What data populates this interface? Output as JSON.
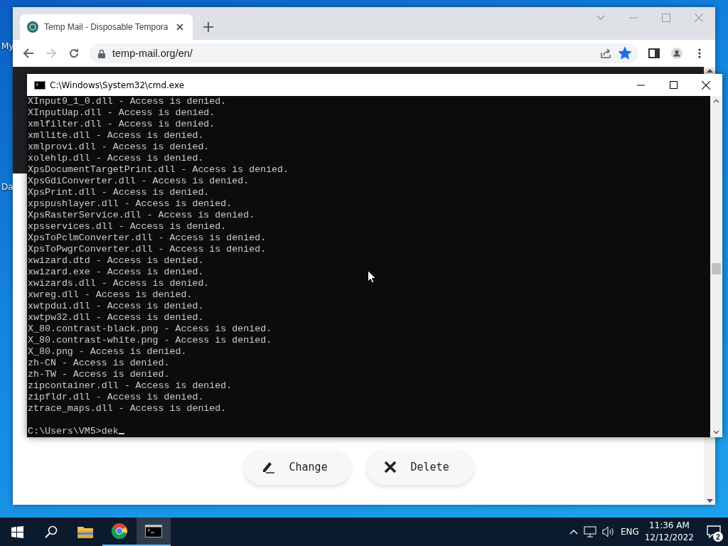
{
  "desktop": {
    "icon_labels": [
      "My",
      "Da"
    ]
  },
  "browser": {
    "tab": {
      "title": "Temp Mail - Disposable Tempora",
      "selected": true
    },
    "address": "temp-mail.org/en/",
    "bookmarked": true,
    "buttons": [
      {
        "label": "Change",
        "kind": "edit"
      },
      {
        "label": "Delete",
        "kind": "delete"
      }
    ]
  },
  "cmd": {
    "title": "C:\\Windows\\System32\\cmd.exe",
    "lines": [
      "XInput9_1_0.dll - Access is denied.",
      "XInputUap.dll - Access is denied.",
      "xmlfilter.dll - Access is denied.",
      "xmllite.dll - Access is denied.",
      "xmlprovi.dll - Access is denied.",
      "xolehlp.dll - Access is denied.",
      "XpsDocumentTargetPrint.dll - Access is denied.",
      "XpsGdiConverter.dll - Access is denied.",
      "XpsPrint.dll - Access is denied.",
      "xpspushlayer.dll - Access is denied.",
      "XpsRasterService.dll - Access is denied.",
      "xpsservices.dll - Access is denied.",
      "XpsToPclmConverter.dll - Access is denied.",
      "XpsToPwgrConverter.dll - Access is denied.",
      "xwizard.dtd - Access is denied.",
      "xwizard.exe - Access is denied.",
      "xwizards.dll - Access is denied.",
      "xwreg.dll - Access is denied.",
      "xwtpdui.dll - Access is denied.",
      "xwtpw32.dll - Access is denied.",
      "X_80.contrast-black.png - Access is denied.",
      "X_80.contrast-white.png - Access is denied.",
      "X_80.png - Access is denied.",
      "zh-CN - Access is denied.",
      "zh-TW - Access is denied.",
      "zipcontainer.dll - Access is denied.",
      "zipfldr.dll - Access is denied.",
      "ztrace_maps.dll - Access is denied."
    ],
    "prompt": "C:\\Users\\VM5>",
    "input": "dek"
  },
  "taskbar": {
    "apps": [
      {
        "kind": "folder",
        "running": false,
        "selected": false
      },
      {
        "kind": "chrome",
        "running": true,
        "selected": false
      },
      {
        "kind": "terminal",
        "running": true,
        "selected": true
      }
    ],
    "language": "ENG",
    "time": "11:36 AM",
    "date": "12/12/2022",
    "notifications": "2"
  }
}
